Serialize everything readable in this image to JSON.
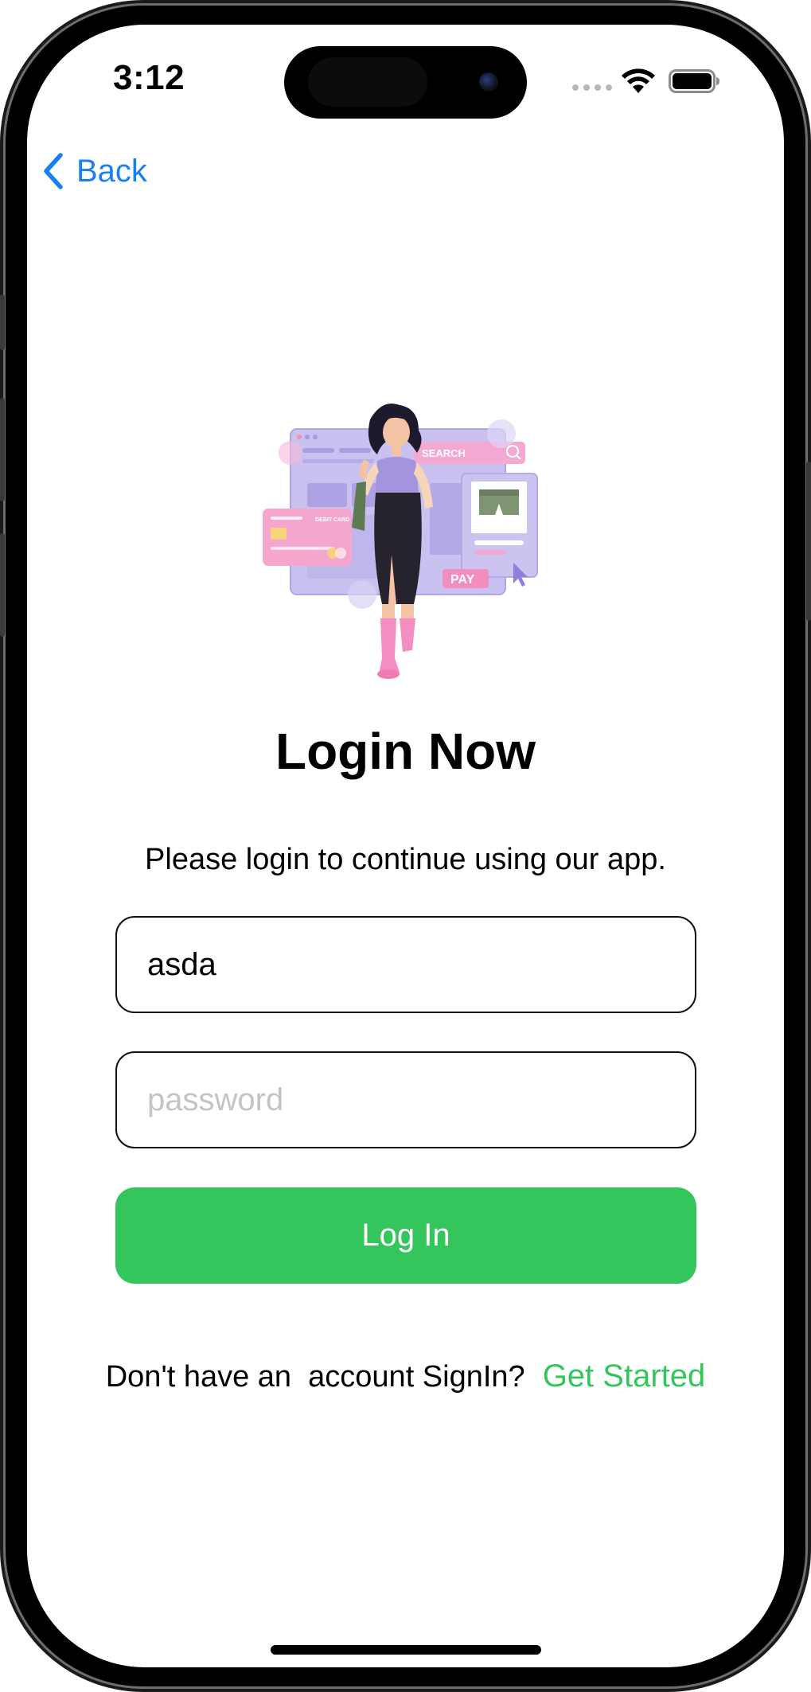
{
  "status_bar": {
    "time": "3:12",
    "icons": [
      "cellular-signal-icon",
      "wifi-icon",
      "battery-icon"
    ]
  },
  "nav": {
    "back_label": "Back",
    "back_icon": "chevron-left-icon"
  },
  "illustration": {
    "description_icon": "shopping-woman-illustration",
    "texts": {
      "search": "SEARCH",
      "debit_card": "DEBIT CARD",
      "pay": "PAY"
    }
  },
  "login": {
    "title": "Login Now",
    "subtitle": "Please login to continue using our app.",
    "username_value": "asda",
    "password_value": "",
    "password_placeholder": "password",
    "button_label": "Log In"
  },
  "footer": {
    "prompt": "Don't have an  account SignIn?",
    "link_label": "Get Started"
  },
  "colors": {
    "accent_green": "#34c65c",
    "link_blue": "#1a7ff2",
    "illustration_purple": "#b9aee6",
    "illustration_pink": "#f49ac8"
  }
}
